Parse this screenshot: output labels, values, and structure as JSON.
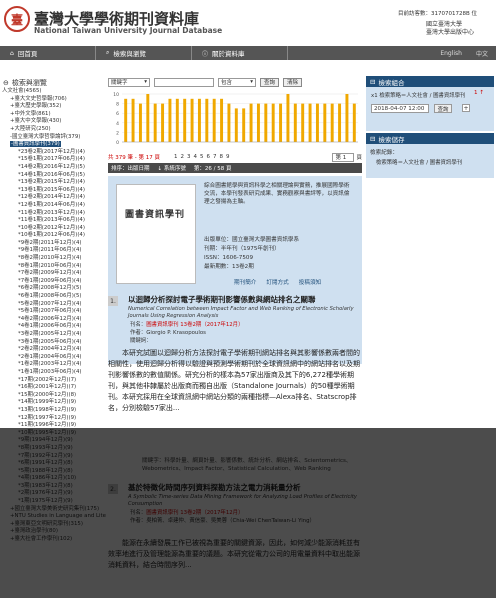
{
  "header": {
    "site_title": "臺灣大學學術期刊資料庫",
    "site_subtitle": "National Taiwan University Journal Database",
    "visitor": "目前訪客數：3170701728B 位",
    "org_line1": "國立臺灣大學",
    "org_line2": "臺灣大學出版中心"
  },
  "nav": {
    "items": [
      "回首頁",
      "檢索與瀏覽",
      "關於資料庫"
    ],
    "lang_en": "English",
    "lang_zh": "中文"
  },
  "left": {
    "title": "檢索與瀏覽",
    "tree": [
      {
        "label": "人文社會(4565)",
        "indent": 0,
        "sel": false
      },
      {
        "label": "+臺大文史哲學報(706)",
        "indent": 1
      },
      {
        "label": "+臺大歷史學報(352)",
        "indent": 1
      },
      {
        "label": "+中外文學(861)",
        "indent": 1
      },
      {
        "label": "+臺大中文學報(430)",
        "indent": 1
      },
      {
        "label": "+大陸研究(250)",
        "indent": 1
      },
      {
        "label": "-國立臺灣大學哲學論評(379)",
        "indent": 1
      },
      {
        "label": "-圖書資訊學刊(379)",
        "indent": 1,
        "sel": true
      },
      {
        "label": "*23卷2期(2017年12月)(4)",
        "indent": 2
      },
      {
        "label": "*15卷1期(2017年06月)(4)",
        "indent": 2
      },
      {
        "label": "*14卷2期(2016年12月)(5)",
        "indent": 2
      },
      {
        "label": "*14卷1期(2016年06月)(5)",
        "indent": 2
      },
      {
        "label": "*13卷2期(2015年12月)(4)",
        "indent": 2
      },
      {
        "label": "*13卷1期(2015年06月)(4)",
        "indent": 2
      },
      {
        "label": "*12卷2期(2014年12月)(4)",
        "indent": 2
      },
      {
        "label": "*12卷1期(2014年06月)(4)",
        "indent": 2
      },
      {
        "label": "*11卷2期(2013年12月)(4)",
        "indent": 2
      },
      {
        "label": "*11卷1期(2013年06月)(4)",
        "indent": 2
      },
      {
        "label": "*10卷2期(2012年12月)(4)",
        "indent": 2
      },
      {
        "label": "*10卷1期(2012年06月)(4)",
        "indent": 2
      },
      {
        "label": "*9卷2期(2011年12月)(4)",
        "indent": 2
      },
      {
        "label": "*9卷1期(2011年06月)(4)",
        "indent": 2
      },
      {
        "label": "*8卷2期(2010年12月)(4)",
        "indent": 2
      },
      {
        "label": "*8卷1期(2010年06月)(4)",
        "indent": 2
      },
      {
        "label": "*7卷2期(2009年12月)(4)",
        "indent": 2
      },
      {
        "label": "*7卷1期(2009年06月)(4)",
        "indent": 2
      },
      {
        "label": "*6卷2期(2008年12月)(5)",
        "indent": 2
      },
      {
        "label": "*6卷1期(2008年06月)(5)",
        "indent": 2
      },
      {
        "label": "*5卷2期(2007年12月)(4)",
        "indent": 2
      },
      {
        "label": "*5卷1期(2007年06月)(4)",
        "indent": 2
      },
      {
        "label": "*4卷2期(2006年12月)(4)",
        "indent": 2
      },
      {
        "label": "*4卷1期(2006年06月)(4)",
        "indent": 2
      },
      {
        "label": "*3卷2期(2005年12月)(4)",
        "indent": 2
      },
      {
        "label": "*3卷1期(2005年06月)(4)",
        "indent": 2
      },
      {
        "label": "*2卷2期(2004年12月)(4)",
        "indent": 2
      },
      {
        "label": "*2卷1期(2004年06月)(4)",
        "indent": 2
      },
      {
        "label": "*1卷2期(2003年12月)(4)",
        "indent": 2
      },
      {
        "label": "*1卷1期(2003年06月)(4)",
        "indent": 2
      },
      {
        "label": "*17期(2002年12月)(7)",
        "indent": 2
      },
      {
        "label": "*16期(2001年12月)(7)",
        "indent": 2
      },
      {
        "label": "*15期(2000年12月)(8)",
        "indent": 2
      },
      {
        "label": "*14期(1999年12月)(9)",
        "indent": 2
      },
      {
        "label": "*13期(1998年12月)(9)",
        "indent": 2
      },
      {
        "label": "*12期(1997年12月)(9)",
        "indent": 2
      },
      {
        "label": "*11期(1996年12月)(9)",
        "indent": 2
      },
      {
        "label": "*10期(1995年12月)(9)",
        "indent": 2
      },
      {
        "label": "*9期(1994年12月)(9)",
        "indent": 2
      },
      {
        "label": "*8期(1993年12月)(9)",
        "indent": 2
      },
      {
        "label": "*7期(1992年12月)(9)",
        "indent": 2
      },
      {
        "label": "*6期(1991年12月)(8)",
        "indent": 2
      },
      {
        "label": "*5期(1988年12月)(8)",
        "indent": 2
      },
      {
        "label": "*4期(1986年12月)(10)",
        "indent": 2
      },
      {
        "label": "*3期(1983年12月)(8)",
        "indent": 2
      },
      {
        "label": "*2期(1976年12月)(9)",
        "indent": 2
      },
      {
        "label": "*1期(1975年12月)(9)",
        "indent": 2
      },
      {
        "label": "+國立臺灣大學美術史研究集刊(175)",
        "indent": 1
      },
      {
        "label": "+NTU Studies in Language and Literature(154)",
        "indent": 1
      },
      {
        "label": "+臺灣東亞文明研究學刊(315)",
        "indent": 1
      },
      {
        "label": "+臺灣政治學刊(80)",
        "indent": 1
      },
      {
        "label": "+臺大社會工作學刊(102)",
        "indent": 1
      }
    ]
  },
  "search": {
    "field": "關鍵字",
    "op": "包含",
    "button": "查詢",
    "clear": "清除"
  },
  "chart_data": {
    "type": "bar",
    "categories": [
      "1975",
      "1976",
      "1983",
      "1986",
      "1988",
      "1991",
      "1992",
      "1993",
      "1994",
      "1995",
      "1996",
      "1997",
      "1998",
      "1999",
      "2000",
      "2001",
      "2002",
      "2003",
      "2004",
      "2005",
      "2006",
      "2007",
      "2008",
      "2009",
      "2010",
      "2011",
      "2012",
      "2013",
      "2014",
      "2015",
      "2016",
      "2017"
    ],
    "values": [
      9,
      9,
      8,
      10,
      8,
      8,
      9,
      9,
      9,
      9,
      9,
      9,
      9,
      9,
      8,
      7,
      7,
      8,
      8,
      8,
      8,
      8,
      10,
      8,
      8,
      8,
      8,
      8,
      8,
      8,
      10,
      8
    ],
    "ylim": [
      0,
      10
    ],
    "yticks": [
      "10",
      "8",
      "6",
      "4",
      "2",
      "0"
    ]
  },
  "pager": {
    "total": "共 379 筆 - 第 17 頁",
    "pages": [
      "1",
      "2",
      "3",
      "4",
      "5",
      "6",
      "7",
      "8",
      "9"
    ],
    "per": "第 1",
    "unit": "頁"
  },
  "sortbar": {
    "order": "排序：出版日期",
    "dir": "↓ 系統序號",
    "page": "第：26 / 58 頁"
  },
  "intro": {
    "cover_title": "圖書資訊學刊",
    "text": "綜合圖書館學與資訊科學之相關理論與實務，推展國際學術交流，本學刊發表研究成果、實務觀察與書評等，以資訊倫理之發揚為主軸。",
    "facts": [
      "出版單位：國立臺灣大學圖書資訊學系",
      "刊期：半年刊（1975年創刊）",
      "ISSN：1606-7509",
      "最新期數：13卷2期"
    ],
    "links": [
      "期刊簡介",
      "訂閱方式",
      "投稿須知"
    ]
  },
  "articles": [
    {
      "num": "1.",
      "title": "以迴歸分析探討電子學術期刊影響係數與網站排名之關聯",
      "etitle": "Numerical Correlation between Impact Factor and Web Ranking of Electronic Scholarly Journals Using Regression Analysis",
      "journal_lbl": "刊名：",
      "journal": "圖書資訊學刊 13卷2期（2017年12月）",
      "author_lbl": "作者：",
      "author": "Giorgio P. Krasopoulos",
      "kw_lbl": "關鍵詞：",
      "abstract": "本研究試圖以迴歸分析方法探討電子學術期刊網站排名與其影響係數兩者間的相關性，使用迴歸分析得以驗證與預測學術期刊於全球資訊網中的網站排名以及期刊影響係數的數值關係。研究分析的樣本為57家出版商及其下的6,272種學術期刊，與其他非隸屬於出版商而獨自出版（Standalone Journals）的50種學術期刊。本研究採用在全球資訊網中網站分類的兩種指標—Alexa排名、Statscrop排名，分別檢驗57家出...",
      "keywords": "關鍵字：科學計量、網頁計量、影響係數、統計分析、網站排名、Scientometrics、Webometrics、Impact Factor、Statistical Calculation、Web Ranking"
    },
    {
      "num": "2.",
      "title": "基於特徵化時間序列資料探勘方法之電力消耗量分析",
      "etitle": "A Symbolic Time-series Data Mining Framework for Analyzing Load Profiles of Electricity Consumption",
      "journal_lbl": "刊名：",
      "journal": "圖書資訊學刊 13卷2期（2017年12月）",
      "author_lbl": "作者：",
      "author": "吳柏菁、卓建仲、黃信豪、吳美蓉（Chia-Wei ChenTaiwan-Li Ying）",
      "abstract": "能源在永續發展工作已被視為重要的關鍵資源，因此，如何減少能源消耗並有效率地進行及管理能源為重要的議題。本研究從電力公司的用電量資料中取出能源消耗資料，結合時間序列..."
    }
  ],
  "right": {
    "hold_title": "檢索組合",
    "hold_record": "x1 檢索策略＝人文社會 / 圖書資訊學刊",
    "hold_count": "1 ↑",
    "date": "2018-04-07 12:00",
    "go": "查詢",
    "tag_title": "檢索儲存",
    "tag_label": "檢索紀錄：",
    "tag_link": "檢索策略＝人文社會 / 圖書資訊學刊"
  },
  "colors": {
    "nav": "#555555",
    "accent": "#1f4e79",
    "bar": "#f0a800",
    "panel": "#cfe0f0"
  }
}
